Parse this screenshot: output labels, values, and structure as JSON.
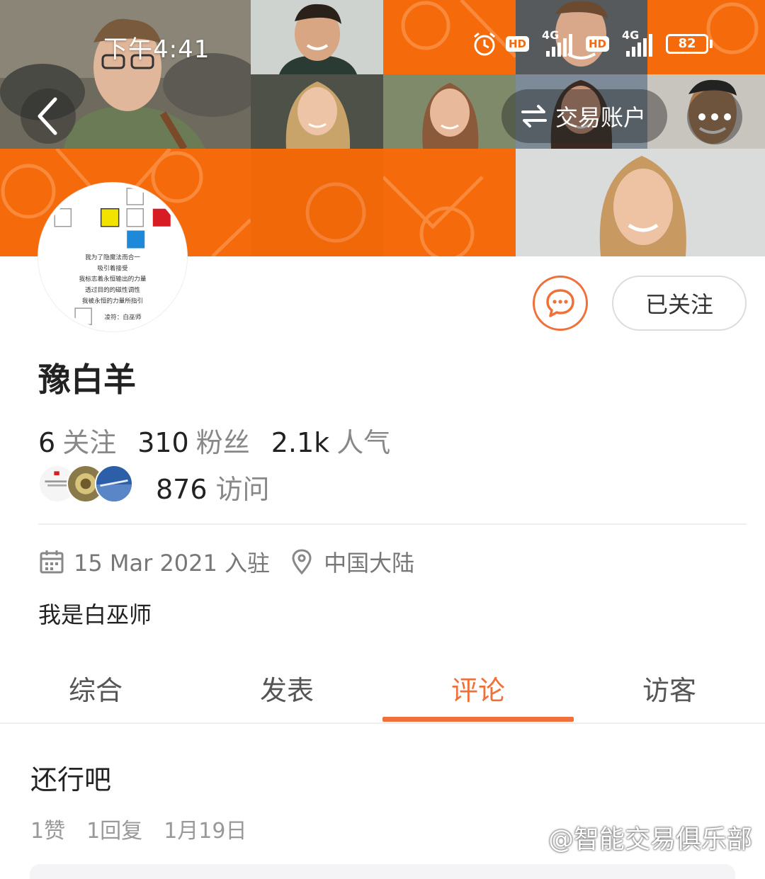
{
  "status_bar": {
    "time": "下午4:41",
    "hd_1": "HD",
    "net_1": "4G",
    "hd_2": "HD",
    "net_2": "4G",
    "battery": "82"
  },
  "header": {
    "trade_account_label": "交易账户",
    "icons": [
      "back-icon",
      "swap-icon",
      "more-icon"
    ]
  },
  "profile": {
    "username": "豫白羊",
    "follow_button_label": "已关注",
    "stats": [
      {
        "value": "6",
        "label": "关注"
      },
      {
        "value": "310",
        "label": "粉丝"
      },
      {
        "value": "2.1k",
        "label": "人气"
      }
    ],
    "visits": {
      "value": "876",
      "label": "访问"
    },
    "join_date": "15 Mar 2021 入驻",
    "location": "中国大陆",
    "bio": "我是白巫师"
  },
  "avatar_text": [
    "我为了隐魔法而合一",
    "吸引着接受",
    "我标志着永恒输出的力量",
    "透过目的的磁性调性",
    "我被永恒的力量所指引",
    "凌符：白巫师"
  ],
  "tabs": [
    {
      "label": "综合",
      "active": false
    },
    {
      "label": "发表",
      "active": false
    },
    {
      "label": "评论",
      "active": true
    },
    {
      "label": "访客",
      "active": false
    }
  ],
  "comment": {
    "text": "还行吧",
    "likes": "1赞",
    "replies": "1回复",
    "date": "1月19日"
  },
  "watermark": "@智能交易俱乐部",
  "colors": {
    "accent": "#f0703a",
    "banner_orange": "#f56a0a"
  }
}
